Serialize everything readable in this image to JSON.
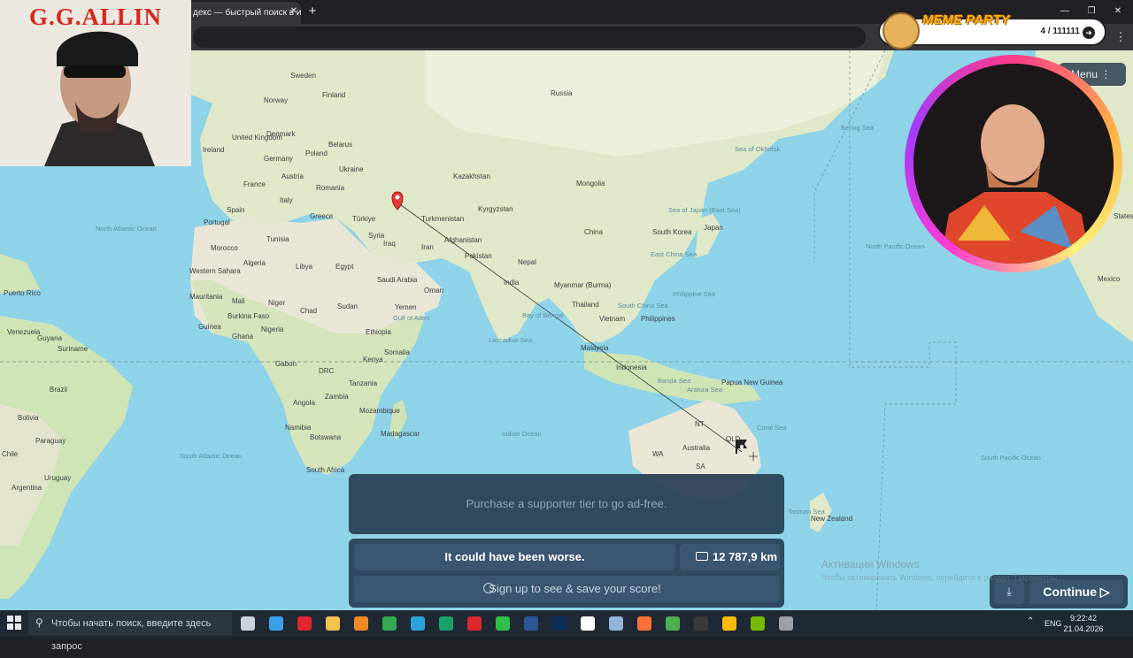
{
  "browser": {
    "tab_title": "декс — быстрый поиск в и",
    "tab_close": "✕",
    "new_tab": "+",
    "window_controls": [
      "—",
      "❐",
      "✕"
    ],
    "menu_glyph": "⋮"
  },
  "overlay_left": {
    "title": "G.G.ALLIN"
  },
  "meme_party": {
    "title": "MEME PARTY",
    "counter": "4 / 111111",
    "arrow": "➜"
  },
  "game": {
    "menu_label": "Menu",
    "menu_glyph": "⋮",
    "ad_text": "Purchase a supporter tier to go ad-free.",
    "result_text": "It could have been worse.",
    "distance": "12 787,9 km",
    "signup_text": "Sign up to see & save your score!",
    "continue_label": "Continue ▷",
    "download_glyph": "⤓"
  },
  "map": {
    "guess_marker_color": "#e53935",
    "country_labels": [
      "Sweden",
      "Finland",
      "Norway",
      "Russia",
      "Denmark",
      "United Kingdom",
      "Ireland",
      "Belarus",
      "Germany",
      "Poland",
      "Ukraine",
      "Austria",
      "France",
      "Romania",
      "Italy",
      "Spain",
      "Portugal",
      "Greece",
      "Türkiye",
      "Kazakhstan",
      "Mongolia",
      "Kyrgyzstan",
      "Turkmenistan",
      "Afghanistan",
      "China",
      "South Korea",
      "Japan",
      "Iran",
      "Iraq",
      "Syria",
      "Pakistan",
      "Nepal",
      "India",
      "Myanmar (Burma)",
      "Thailand",
      "Vietnam",
      "Philippines",
      "Malaysia",
      "Indonesia",
      "Papua New Guinea",
      "Australia",
      "New Zealand",
      "Tunisia",
      "Morocco",
      "Algeria",
      "Libya",
      "Egypt",
      "Saudi Arabia",
      "Oman",
      "Yemen",
      "Western Sahara",
      "Mauritania",
      "Mali",
      "Niger",
      "Chad",
      "Sudan",
      "Ethiopia",
      "Somalia",
      "Kenya",
      "Burkina Faso",
      "Guinea",
      "Nigeria",
      "Ghana",
      "Gabon",
      "DRC",
      "Tanzania",
      "Angola",
      "Zambia",
      "Mozambique",
      "Namibia",
      "Botswana",
      "Madagascar",
      "South Africa",
      "Puerto Rico",
      "Venezuela",
      "Guyana",
      "Suriname",
      "Brazil",
      "Bolivia",
      "Paraguay",
      "Chile",
      "Uruguay",
      "Argentina",
      "Mexico",
      "States"
    ],
    "ocean_labels": [
      "North Atlantic Ocean",
      "South Atlantic Ocean",
      "Indian Ocean",
      "North Pacific Ocean",
      "South Pacific Ocean",
      "Bering Sea",
      "Sea of Okhotsk",
      "Sea of Japan (East Sea)",
      "East China Sea",
      "South China Sea",
      "Philippine Sea",
      "Bay of Bengal",
      "Laccadive Sea",
      "Gulf of Aden",
      "Banda Sea",
      "Arafura Sea",
      "Coral Sea",
      "Tasman Sea"
    ],
    "region_labels": [
      "WA",
      "NT",
      "SA",
      "QLD"
    ]
  },
  "windows_watermark": {
    "title": "Активация Windows",
    "subtitle": "Чтобы активировать Windows, перейдите в раздел \"Параметры\"."
  },
  "taskbar": {
    "search_placeholder": "Чтобы начать поиск, введите здесь запрос",
    "search_glyph": "⚲",
    "chevron": "⌃",
    "language": "ENG",
    "time": "9:22:42",
    "date": "21.04.2026",
    "app_icons": [
      {
        "name": "task-view-icon",
        "color": "#c9d1d9"
      },
      {
        "name": "file-explorer-icon",
        "color": "#3aa0e8"
      },
      {
        "name": "opera-icon",
        "color": "#e0262f"
      },
      {
        "name": "folder-icon",
        "color": "#f2c14e"
      },
      {
        "name": "vlc-icon",
        "color": "#f08a24"
      },
      {
        "name": "app-icon",
        "color": "#34a853"
      },
      {
        "name": "telegram-icon",
        "color": "#2aa3df"
      },
      {
        "name": "app-icon",
        "color": "#1aa16b"
      },
      {
        "name": "opera-gx-icon",
        "color": "#e0262f"
      },
      {
        "name": "app-icon",
        "color": "#2fbf4a"
      },
      {
        "name": "word-icon",
        "color": "#2b579a"
      },
      {
        "name": "photoshop-icon",
        "color": "#0b2d57"
      },
      {
        "name": "yandex-icon",
        "color": "#ffffff"
      },
      {
        "name": "app-icon",
        "color": "#8fb3d9"
      },
      {
        "name": "firefox-icon",
        "color": "#ff7139"
      },
      {
        "name": "chrome-icon",
        "color": "#4caf50"
      },
      {
        "name": "obs-icon",
        "color": "#3a3a3a"
      },
      {
        "name": "chrome-icon",
        "color": "#fbbc05"
      },
      {
        "name": "nvidia-icon",
        "color": "#76b900"
      },
      {
        "name": "app-icon",
        "color": "#9aa0a6"
      }
    ]
  }
}
